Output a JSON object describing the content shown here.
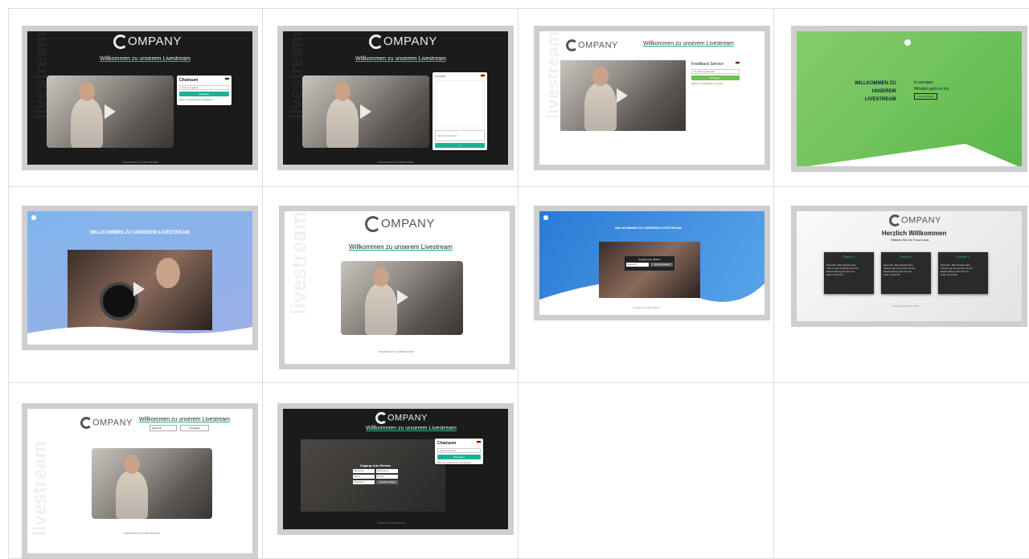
{
  "brand": "OMPANY",
  "welcome": "Willkommen zu unserem Livestream",
  "welcome_caps": "WILLKOMMEN ZU UNSEREM LIVESTREAM",
  "footer": "Impressum | Datenschutz",
  "side_word": "livestream",
  "chat": {
    "title": "Chatraum",
    "name_placeholder": "Name eingeben",
    "button": "Einloggen",
    "note": "Bitte ein Gastnamen bestätigen"
  },
  "live_chat": {
    "title": "Live-Chat",
    "input_placeholder": "Ihre Nachricht hier...",
    "send": "✓"
  },
  "feedback": {
    "title": "Feedback Service",
    "name_placeholder": "Ihr Name (optional)",
    "button": "Einloggen",
    "note": "Weiter zu Feedback Formular"
  },
  "green": {
    "left": [
      "WILLKOMMEN ZU",
      "UNSEREM",
      "LIVESTREAM"
    ],
    "right": [
      "In wenigen",
      "Minuten geht es los"
    ],
    "button": "zum Livestream"
  },
  "access": {
    "title": "Zugang zum Stream",
    "password_placeholder": "Passwort",
    "button": "Stream starten"
  },
  "forum": {
    "heading": "Herzlich Willkommen",
    "sub": "Wählen Sie ein Forum aus:",
    "items": [
      {
        "title": "Forum 1",
        "l1": "Sprecher: Max Mustermann",
        "l2": "Thema: Ein wenig Text für die Beschreibung des Forums",
        "time": "Start: 10:00 Uhr"
      },
      {
        "title": "Forum 2",
        "l1": "Sprecher: Max Mustermann",
        "l2": "Thema: Ein wenig Text für die Beschreibung des Forums",
        "time": "Start: 10:00 Uhr"
      },
      {
        "title": "Forum 3",
        "l1": "Sprecher: Max Mustermann",
        "l2": "Thema: Ein wenig Text für die Beschreibung des Forums",
        "time": "Start: 10:00 Uhr"
      }
    ],
    "footer": "Impressum | Datenschutz"
  },
  "password_row": {
    "field": "Passwort",
    "button": "Anmelden"
  },
  "zugang_form": {
    "title": "Zugang zum Stream",
    "f1": "Vorname",
    "f2": "Nachname",
    "f3": "Firma",
    "f4": "E-Mail",
    "f5": "Passwort",
    "button": "Stream starten"
  }
}
